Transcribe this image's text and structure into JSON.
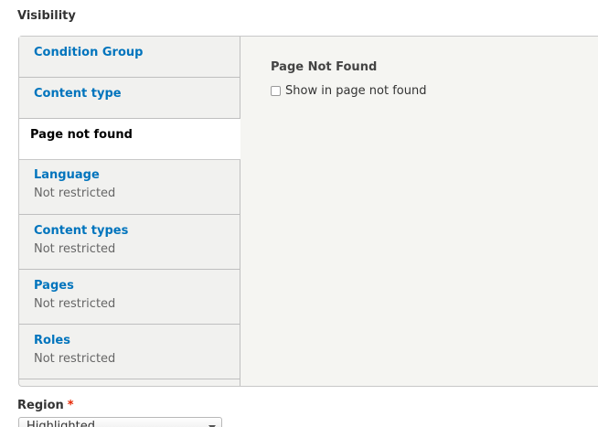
{
  "section_title": "Visibility",
  "tabs": [
    {
      "label": "Condition Group",
      "summary": ""
    },
    {
      "label": "Content type",
      "summary": ""
    },
    {
      "label": "Page not found",
      "summary": "",
      "selected": true
    },
    {
      "label": "Language",
      "summary": "Not restricted"
    },
    {
      "label": "Content types",
      "summary": "Not restricted"
    },
    {
      "label": "Pages",
      "summary": "Not restricted"
    },
    {
      "label": "Roles",
      "summary": "Not restricted"
    }
  ],
  "pane": {
    "title": "Page Not Found",
    "checkbox_label": "Show in page not found",
    "checkbox_checked": false
  },
  "region": {
    "label": "Region",
    "required_mark": "*",
    "selected_value": "Highlighted"
  },
  "colors": {
    "link": "#0074bd",
    "required": "#e62600"
  }
}
